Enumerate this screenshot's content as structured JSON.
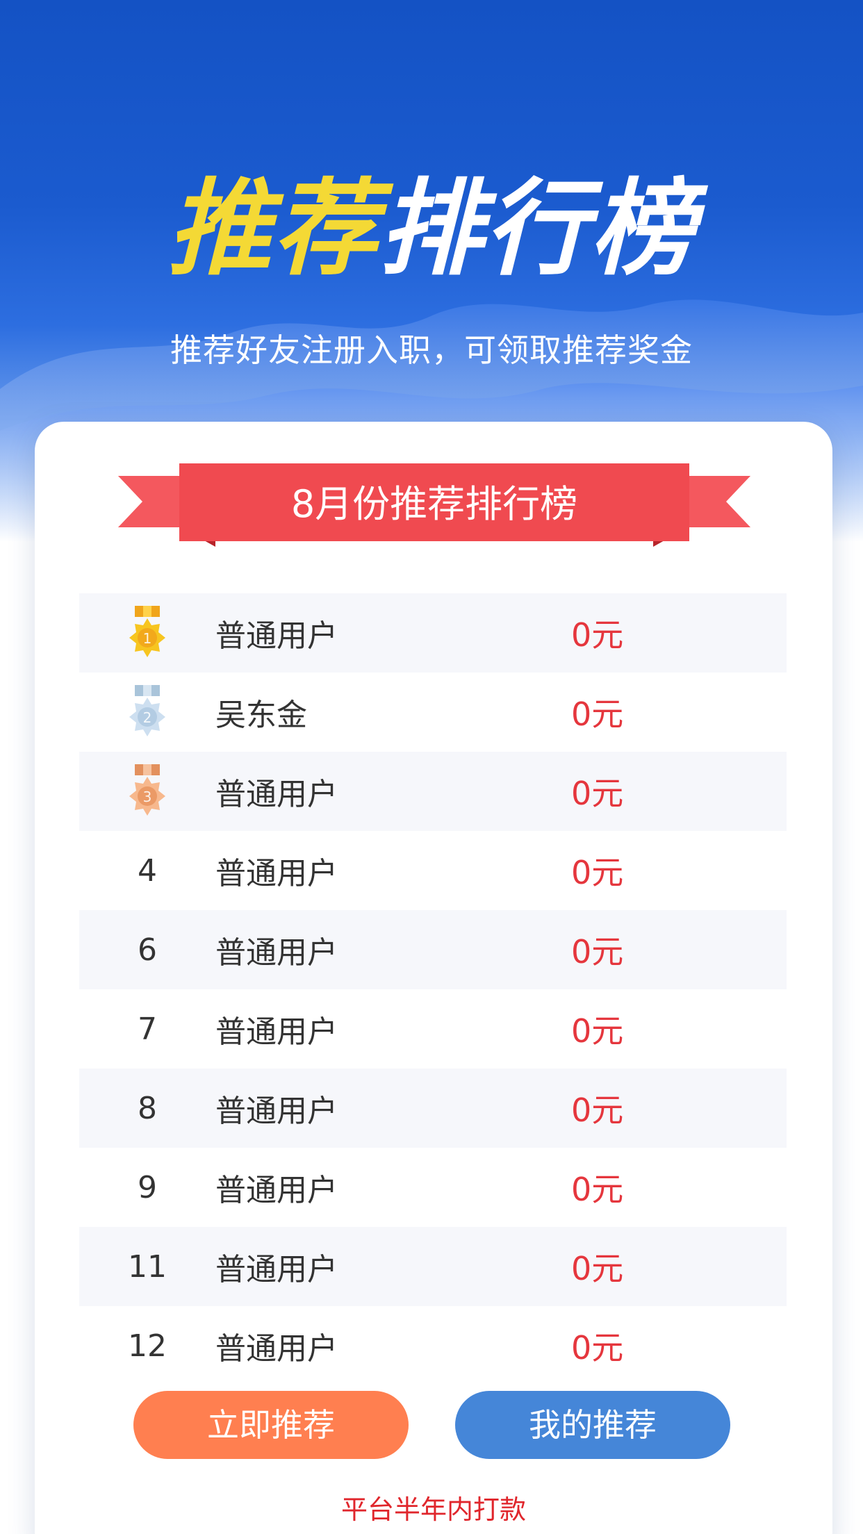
{
  "hero": {
    "title_highlight": "推荐",
    "title_rest": "排行榜",
    "subtitle": "推荐好友注册入职，可领取推荐奖金"
  },
  "board": {
    "ribbon_title": "8月份推荐排行榜",
    "rows": [
      {
        "rank": "1",
        "medal": "gold-medal-icon",
        "name": "普通用户",
        "amount": "0元"
      },
      {
        "rank": "2",
        "medal": "silver-medal-icon",
        "name": "吴东金",
        "amount": "0元"
      },
      {
        "rank": "3",
        "medal": "bronze-medal-icon",
        "name": "普通用户",
        "amount": "0元"
      },
      {
        "rank": "4",
        "name": "普通用户",
        "amount": "0元"
      },
      {
        "rank": "6",
        "name": "普通用户",
        "amount": "0元"
      },
      {
        "rank": "7",
        "name": "普通用户",
        "amount": "0元"
      },
      {
        "rank": "8",
        "name": "普通用户",
        "amount": "0元"
      },
      {
        "rank": "9",
        "name": "普通用户",
        "amount": "0元"
      },
      {
        "rank": "11",
        "name": "普通用户",
        "amount": "0元"
      },
      {
        "rank": "12",
        "name": "普通用户",
        "amount": "0元"
      }
    ]
  },
  "actions": {
    "recommend_now": "立即推荐",
    "my_recommendations": "我的推荐"
  },
  "footer_note": "平台半年内打款",
  "colors": {
    "hero_blue": "#1452c4",
    "highlight_yellow": "#f4d935",
    "ribbon_red": "#f04a50",
    "amount_red": "#e5363d",
    "button_orange": "#ff7f50",
    "button_blue": "#4586d8"
  }
}
